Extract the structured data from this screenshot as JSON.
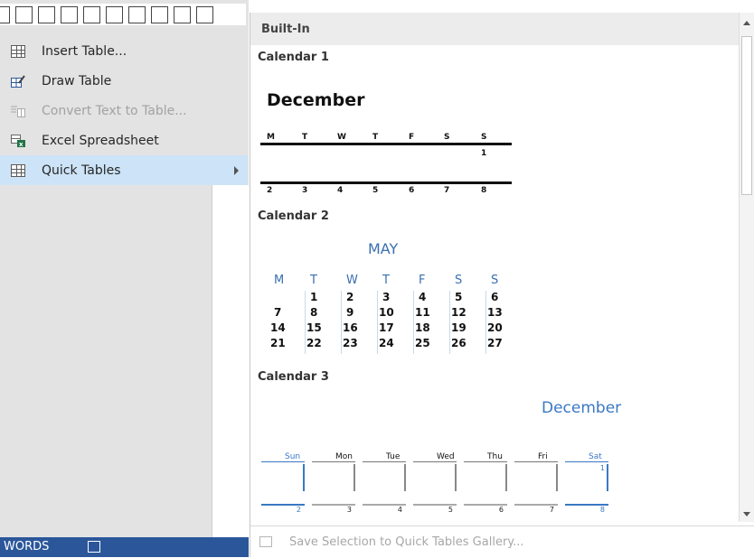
{
  "menu": {
    "items": [
      {
        "label": "Insert Table...",
        "icon": "insert-table-icon",
        "enabled": true
      },
      {
        "label": "Draw Table",
        "icon": "draw-table-icon",
        "enabled": true
      },
      {
        "label": "Convert Text to Table...",
        "icon": "convert-text-icon",
        "enabled": false
      },
      {
        "label": "Excel Spreadsheet",
        "icon": "excel-icon",
        "enabled": true
      },
      {
        "label": "Quick Tables",
        "icon": "quick-tables-icon",
        "enabled": true,
        "submenu": true
      }
    ]
  },
  "statusbar": {
    "words_label": "WORDS"
  },
  "gallery": {
    "section_header": "Built-In",
    "footer_label": "Save Selection to Quick Tables Gallery...",
    "calendar1": {
      "title": "Calendar 1",
      "month": "December",
      "days": [
        "M",
        "T",
        "W",
        "T",
        "F",
        "S",
        "S"
      ],
      "row1_last": "1",
      "row2": [
        "2",
        "3",
        "4",
        "5",
        "6",
        "7",
        "8"
      ]
    },
    "calendar2": {
      "title": "Calendar 2",
      "month": "MAY",
      "days": [
        "M",
        "T",
        "W",
        "T",
        "F",
        "S",
        "S"
      ],
      "weeks": [
        [
          "",
          "1",
          "2",
          "3",
          "4",
          "5",
          "6"
        ],
        [
          "7",
          "8",
          "9",
          "10",
          "11",
          "12",
          "13"
        ],
        [
          "14",
          "15",
          "16",
          "17",
          "18",
          "19",
          "20"
        ],
        [
          "21",
          "22",
          "23",
          "24",
          "25",
          "26",
          "27"
        ]
      ]
    },
    "calendar3": {
      "title": "Calendar 3",
      "month": "December",
      "days": [
        "Sun",
        "Mon",
        "Tue",
        "Wed",
        "Thu",
        "Fri",
        "Sat"
      ],
      "row1_last": "1",
      "row2": [
        "2",
        "3",
        "4",
        "5",
        "6",
        "7",
        "8"
      ]
    }
  },
  "colors": {
    "accent_blue": "#3a78c3",
    "menu_highlight": "#cde3f7",
    "statusbar": "#2b579a"
  }
}
